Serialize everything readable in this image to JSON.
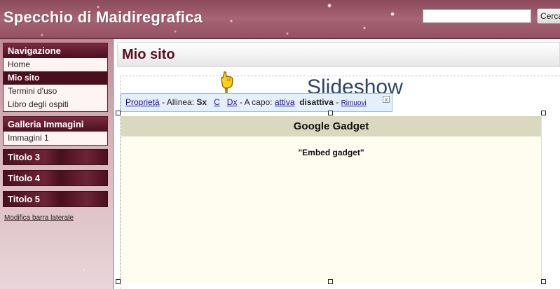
{
  "header": {
    "site_title": "Specchio di Maidiregrafica",
    "search_value": "",
    "search_button": "Cerca"
  },
  "sidebar": {
    "navigation": {
      "title": "Navigazione",
      "items": [
        {
          "label": "Home",
          "active": false
        },
        {
          "label": "Mio sito",
          "active": true
        },
        {
          "label": "Termini d'uso",
          "active": false
        },
        {
          "label": "Libro degli ospiti",
          "active": false
        }
      ]
    },
    "gallery": {
      "title": "Galleria Immagini",
      "items": [
        {
          "label": "Immagini 1"
        }
      ]
    },
    "titles": [
      "Titolo 3",
      "Titolo 4",
      "Titolo 5"
    ],
    "edit_link": "Modifica barra laterale"
  },
  "main": {
    "page_title": "Mio sito",
    "slideshow_text": "Slideshow",
    "toolbar": {
      "properties": "Proprietà",
      "sep1": " - Allinea: ",
      "align_left": "Sx",
      "align_center": "C",
      "align_right": "Dx",
      "sep2": " - A capo: ",
      "wrap_on": "attiva",
      "wrap_off": "disattiva",
      "sep3": " - ",
      "remove": "Rimuovi",
      "close": "x"
    },
    "gadget": {
      "title": "Google Gadget",
      "body": "\"Embed gadget\""
    }
  },
  "colors": {
    "header_bg": "#a76475",
    "nav_head": "#4a0f1f",
    "title_text": "#5a0f1f",
    "toolbar_bg": "#e5effa",
    "gadget_head": "#dad9bf",
    "gadget_bg": "#fefdf0"
  }
}
